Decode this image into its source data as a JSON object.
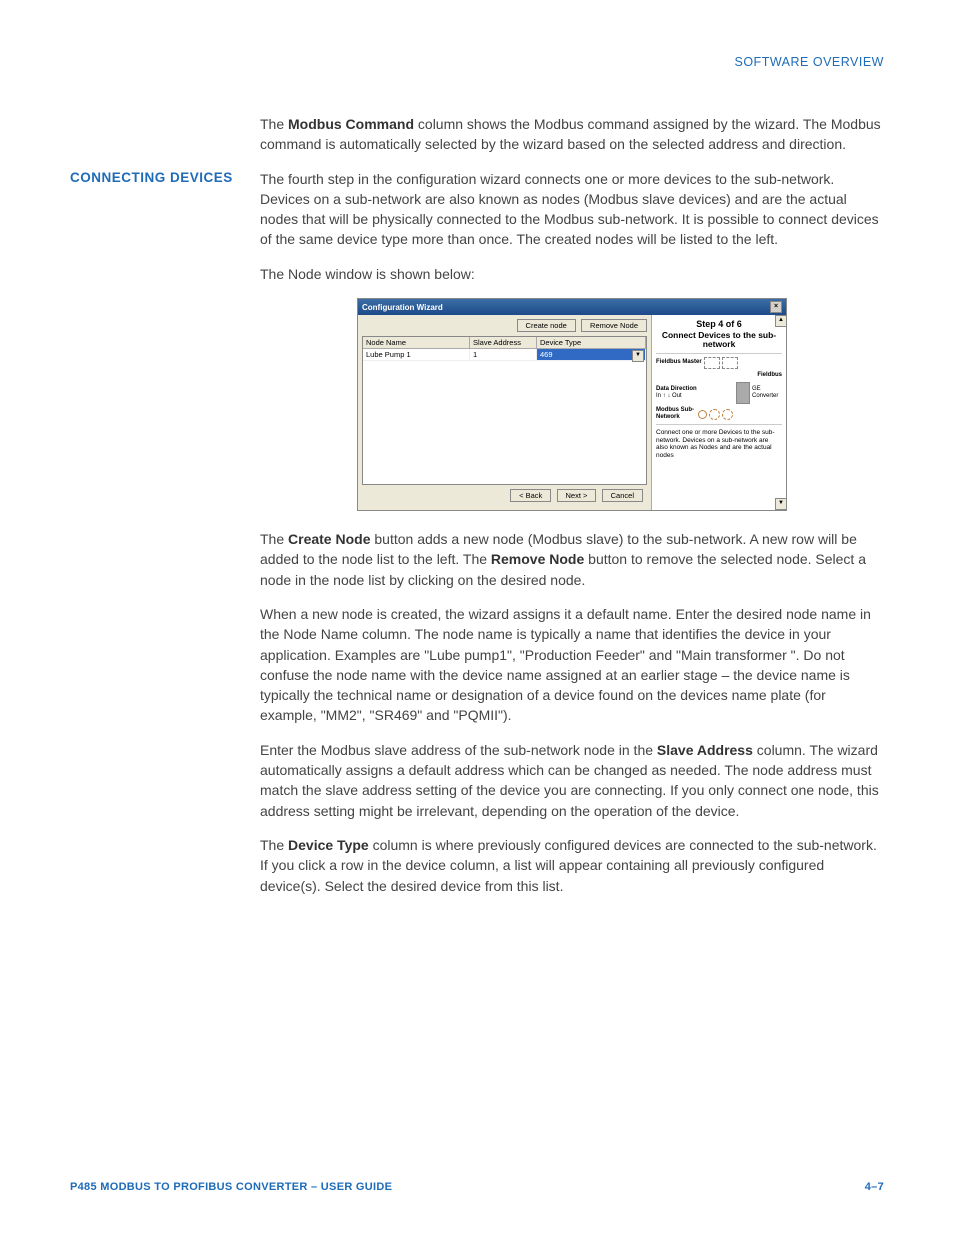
{
  "header": "SOFTWARE OVERVIEW",
  "para1_a": "The ",
  "para1_b": "Modbus Command",
  "para1_c": " column shows the Modbus command assigned by the wizard. The Modbus command is automatically selected by the wizard based on the selected address and direction.",
  "side_label": "CONNECTING DEVICES",
  "para2": "The fourth step in the configuration wizard connects one or more devices to the sub-network. Devices on a sub-network are also known as nodes (Modbus slave devices) and are the actual nodes that will be physically connected to the Modbus sub-network. It is possible to connect devices of the same device type more than once. The created nodes will be listed to the left.",
  "para3": "The Node window is shown below:",
  "win": {
    "title": "Configuration Wizard",
    "btn_create": "Create node",
    "btn_remove": "Remove Node",
    "col1": "Node Name",
    "col2": "Slave Address",
    "col3": "Device Type",
    "row1_c1": "Lube Pump 1",
    "row1_c2": "1",
    "row1_c3": "469",
    "btn_back": "< Back",
    "btn_next": "Next >",
    "btn_cancel": "Cancel",
    "step_title": "Step 4 of 6",
    "step_sub": "Connect Devices to the sub-network",
    "d_fieldbus_master": "Fieldbus Master",
    "d_fieldbus": "Fieldbus",
    "d_data_dir": "Data Direction",
    "d_in": "In",
    "d_out": "Out",
    "d_ge": "GE Converter",
    "d_modbus": "Modbus Sub-Network",
    "help": "Connect one or more Devices to the sub-network. Devices on a sub-network are also known as Nodes and are the actual nodes"
  },
  "para4_a": "The ",
  "para4_b": "Create Node",
  "para4_c": " button adds a new node (Modbus slave) to the sub-network. A new row will be added to the node list to the left. The ",
  "para4_d": "Remove Node",
  "para4_e": " button to remove the selected node. Select a node in the node list by clicking on the desired node.",
  "para5": "When a new node is created, the wizard assigns it a default name. Enter the desired node name in the Node Name column. The node name is typically a name that identifies the device in your application. Examples are \"Lube pump1\", \"Production Feeder\" and \"Main transformer \". Do not confuse the node name with the device name assigned at an earlier stage – the device name is typically the technical name or designation of a device found on the devices name plate (for example, \"MM2\", \"SR469\" and \"PQMII\").",
  "para6_a": "Enter the Modbus slave address of the sub-network node in the ",
  "para6_b": "Slave Address",
  "para6_c": " column. The wizard automatically assigns a default address which can be changed as needed. The node address must match the slave address setting of the device you are connecting. If you only connect one node, this address setting might be irrelevant, depending on the operation of the device.",
  "para7_a": "The ",
  "para7_b": "Device Type",
  "para7_c": " column is where previously configured devices are connected to the sub-network. If you click a row in the device column, a list will appear containing all previously configured device(s). Select the desired device from this list.",
  "footer_left": "P485 MODBUS TO PROFIBUS CONVERTER – USER GUIDE",
  "footer_right": "4–7"
}
